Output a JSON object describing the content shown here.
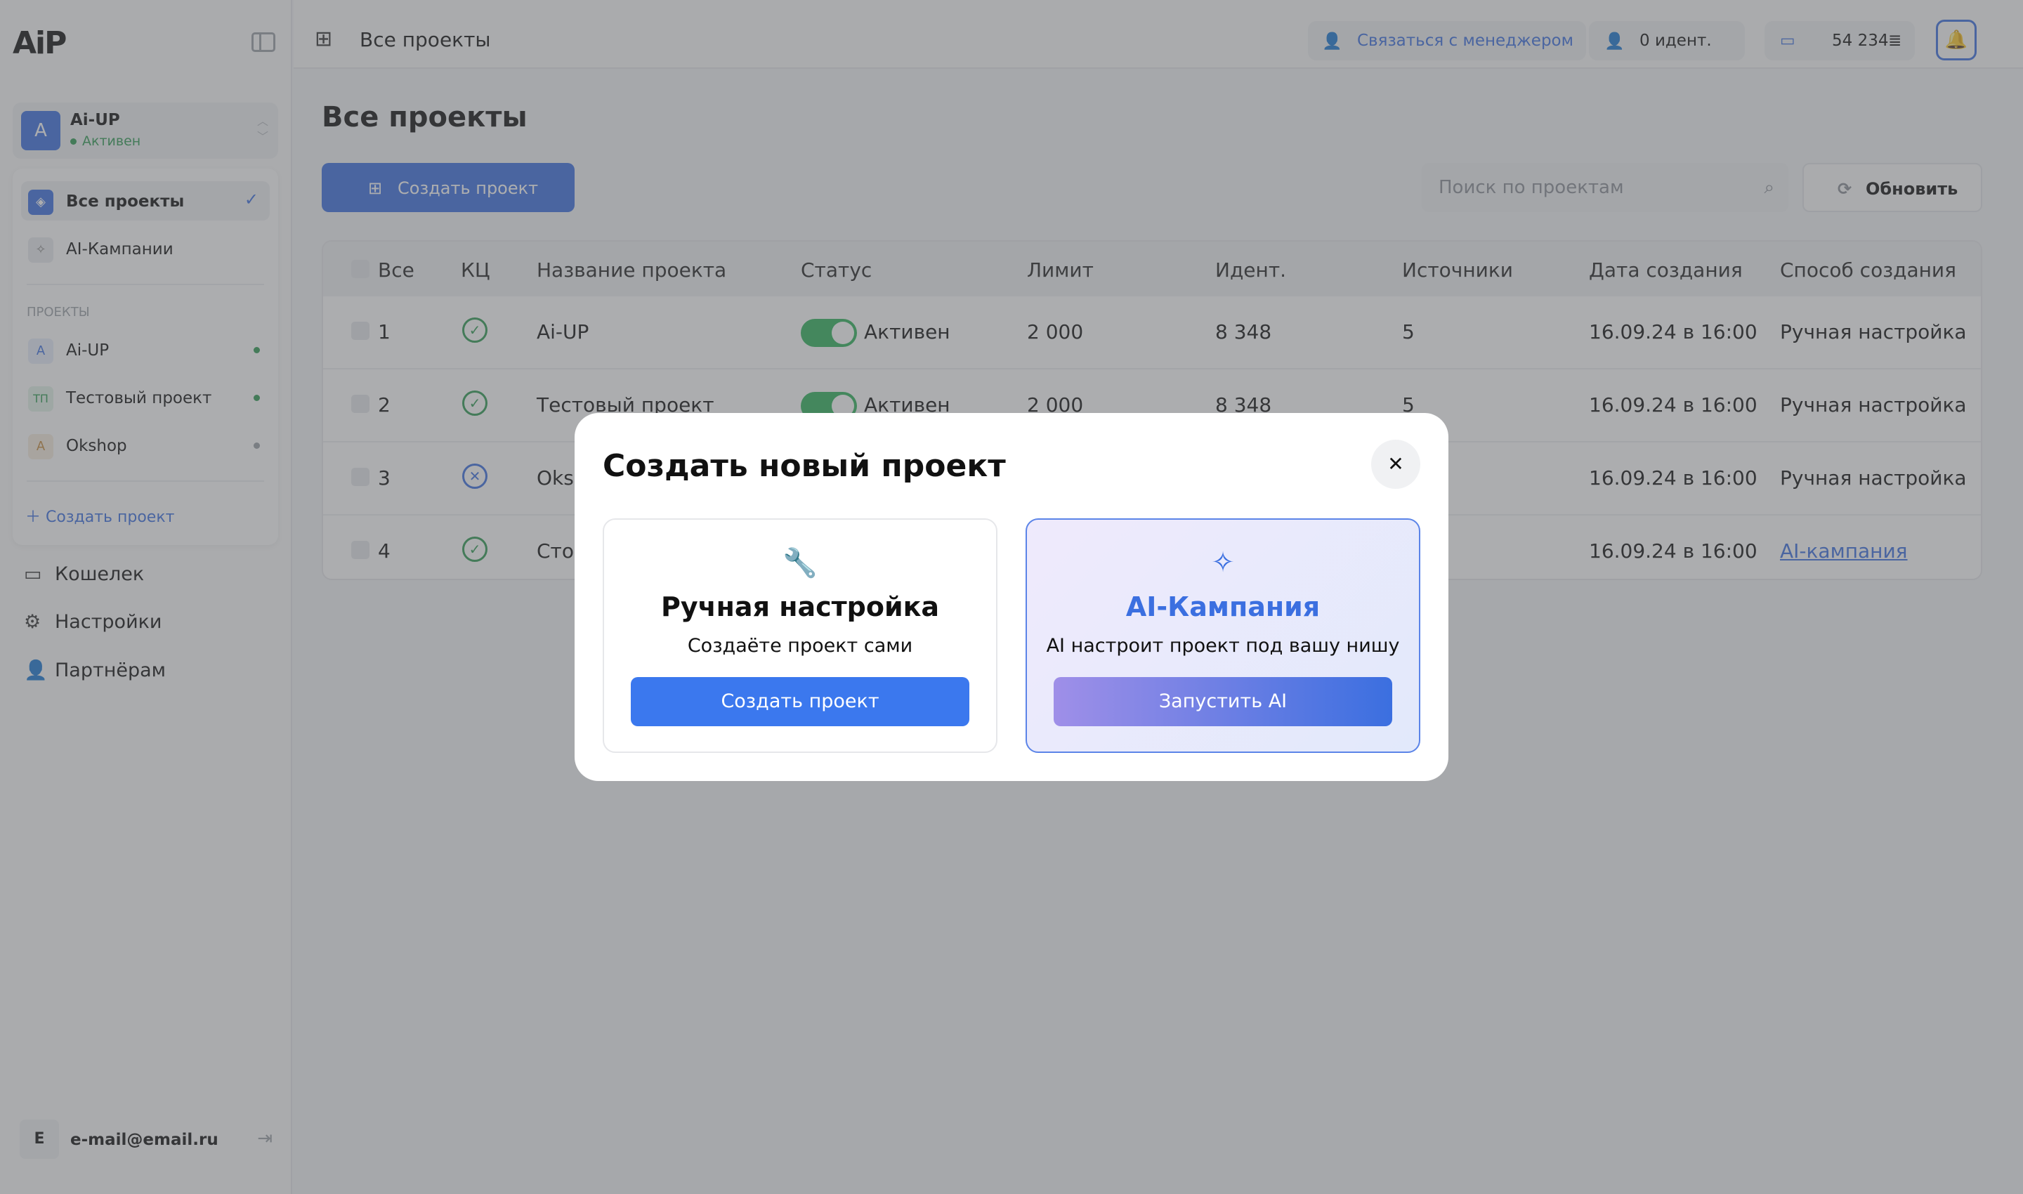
{
  "app": {
    "logo_text": "AiP"
  },
  "workspace": {
    "avatar_letter": "A",
    "name": "Ai-UP",
    "status": "Активен"
  },
  "nav": {
    "all_projects": "Все проекты",
    "ai_campaigns": "AI-Кампании",
    "section_label": "ПРОЕКТЫ",
    "projects": [
      {
        "avatar": "A",
        "name": "Ai-UP",
        "dot_color": "#2e9b52",
        "avatar_bg": "#e7ecfb",
        "avatar_fg": "#3b6fe0"
      },
      {
        "avatar": "ТП",
        "name": "Тестовый проект",
        "dot_color": "#2e9b52",
        "avatar_bg": "#e3f3e8",
        "avatar_fg": "#2e9b52"
      },
      {
        "avatar": "A",
        "name": "Okshop",
        "dot_color": "#9aa0a6",
        "avatar_bg": "#f6ecdf",
        "avatar_fg": "#c48a3c"
      }
    ],
    "create_project": "Создать проект"
  },
  "side_links": {
    "wallet": "Кошелек",
    "settings": "Настройки",
    "partners": "Партнёрам"
  },
  "user": {
    "avatar_letter": "E",
    "email": "e-mail@email.ru"
  },
  "header": {
    "breadcrumb": "Все проекты",
    "contact_manager": "Связаться с менеджером",
    "identifications": "0 идент.",
    "balance": "54 234"
  },
  "main": {
    "title": "Все проекты",
    "create_button": "Создать проект",
    "search_placeholder": "Поиск по проектам",
    "refresh_button": "Обновить"
  },
  "table": {
    "headers": [
      "Все",
      "КЦ",
      "Название проекта",
      "Статус",
      "Лимит",
      "Идент.",
      "Источники",
      "Дата создания",
      "Способ создания"
    ],
    "rows": [
      {
        "num": "1",
        "kc": "ok",
        "name": "Ai-UP",
        "status": "Активен",
        "limit": "2 000",
        "ident": "8 348",
        "sources": "5",
        "date": "16.09.24 в 16:00",
        "method": "Ручная настройка"
      },
      {
        "num": "2",
        "kc": "ok",
        "name": "Тестовый проект",
        "status": "Активен",
        "limit": "2 000",
        "ident": "8 348",
        "sources": "5",
        "date": "16.09.24 в 16:00",
        "method": "Ручная настройка"
      },
      {
        "num": "3",
        "kc": "off",
        "name": "Oksh",
        "date": "16.09.24 в 16:00",
        "method": "Ручная настройка"
      },
      {
        "num": "4",
        "kc": "ok",
        "name": "Стог",
        "date": "16.09.24 в 16:00",
        "method": "AI-кампания"
      }
    ]
  },
  "modal": {
    "title": "Создать новый проект",
    "manual": {
      "title": "Ручная настройка",
      "subtitle": "Создаёте проект сами",
      "button": "Создать проект"
    },
    "ai": {
      "title": "AI-Кампания",
      "subtitle": "AI настроит проект под вашу нишу",
      "button": "Запустить AI"
    }
  },
  "colors": {
    "accent": "#3b6fe0",
    "success": "#2e9b52"
  }
}
